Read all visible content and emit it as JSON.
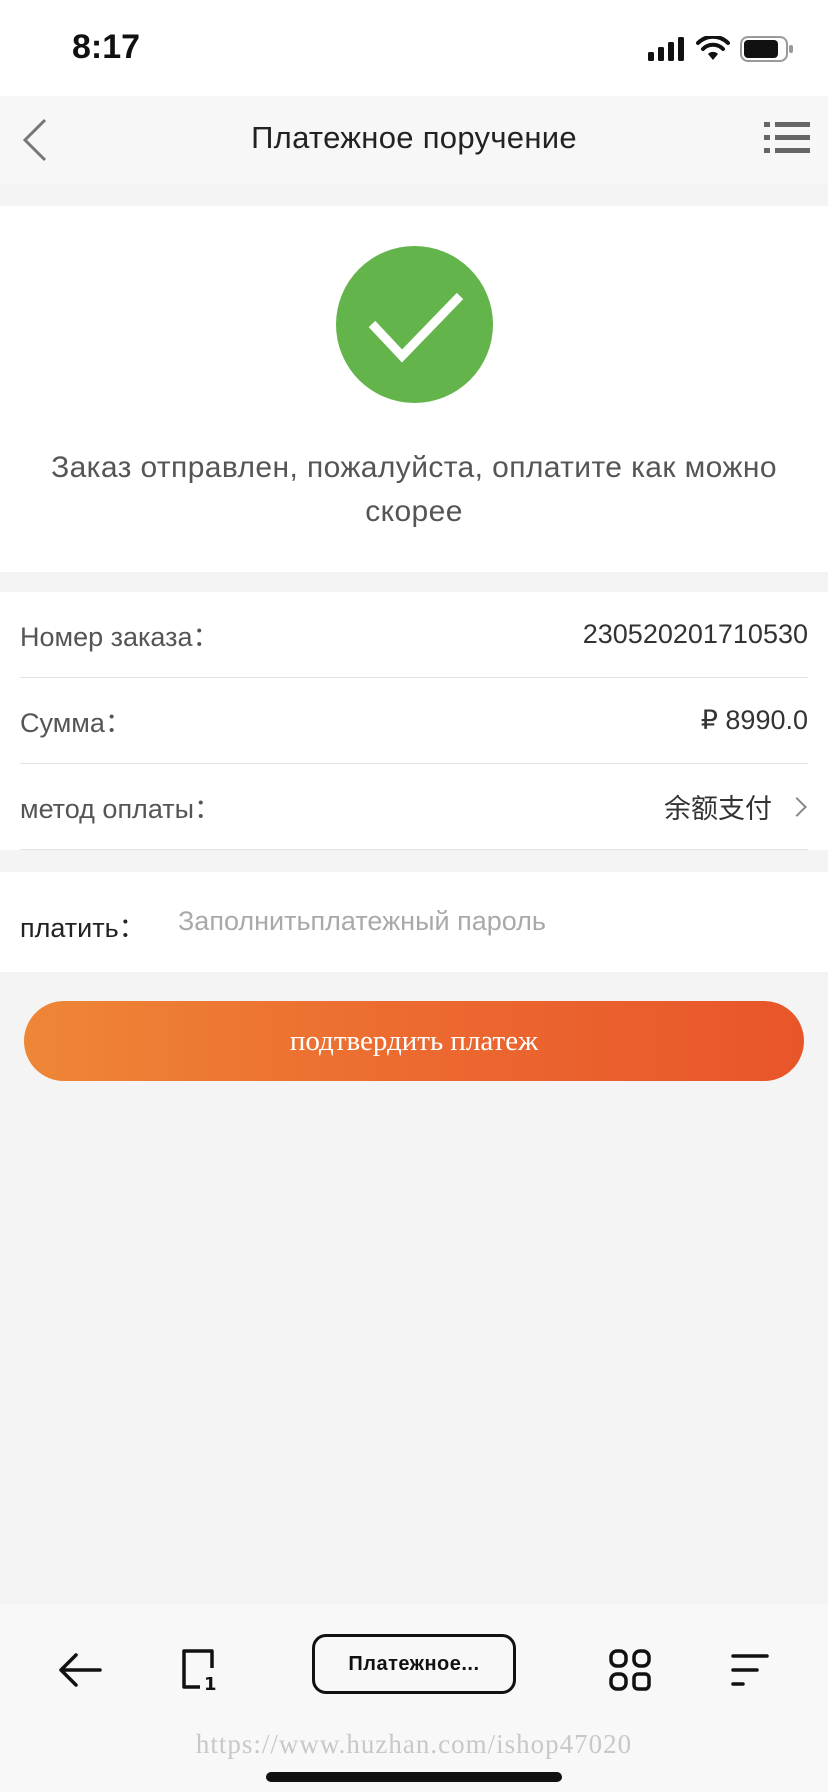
{
  "status_bar": {
    "time": "8:17"
  },
  "nav": {
    "title": "Платежное поручение",
    "back_icon": "chevron-left-icon",
    "menu_icon": "list-menu-icon"
  },
  "success": {
    "icon": "check-circle-icon",
    "message": "Заказ отправлен, пожалуйста, оплатите как можно скорее"
  },
  "order_info": {
    "rows": [
      {
        "label": "Номер заказа：",
        "value": "230520201710530"
      },
      {
        "label": "Сумма：",
        "value": "₽ 8990.0"
      },
      {
        "label": "метод оплаты：",
        "value": "余额支付"
      }
    ]
  },
  "pay": {
    "label": "платить：",
    "placeholder": "Заполнитьплатежный пароль",
    "value": ""
  },
  "confirm_button": {
    "label": "подтвердить платеж"
  },
  "browser_toolbar": {
    "tab_title": "Платежное...",
    "watermark": "https://www.huzhan.com/ishop47020",
    "tab_count": "1"
  },
  "colors": {
    "success_green": "#63b54b",
    "button_gradient_start": "#ee8636",
    "button_gradient_end": "#e8552a",
    "page_bg": "#f4f4f4"
  }
}
